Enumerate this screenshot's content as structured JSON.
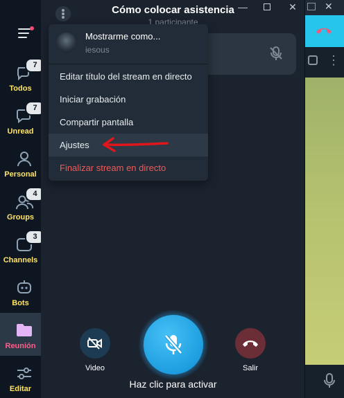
{
  "sidebar": {
    "folders": [
      {
        "label": "Todos",
        "badge": "7",
        "icon": "chat-bubbles-icon"
      },
      {
        "label": "Unread",
        "badge": "7",
        "icon": "chat-bubble-icon"
      },
      {
        "label": "Personal",
        "badge": "",
        "icon": "person-icon"
      },
      {
        "label": "Groups",
        "badge": "4",
        "icon": "people-icon"
      },
      {
        "label": "Channels",
        "badge": "3",
        "icon": "channel-icon"
      },
      {
        "label": "Bots",
        "badge": "",
        "icon": "bot-icon"
      },
      {
        "label": "Reunión",
        "badge": "",
        "icon": "folder-icon"
      },
      {
        "label": "Editar",
        "badge": "",
        "icon": "sliders-icon"
      }
    ]
  },
  "call": {
    "title": "Cómo colocar asistencia",
    "subtitle": "1 participante",
    "buttons": {
      "video": "Video",
      "leave": "Salir",
      "activate": "Haz clic para activar"
    }
  },
  "menu": {
    "profile_name": "Mostrarme como...",
    "profile_user": "iesous",
    "items": [
      "Editar título del stream en directo",
      "Iniciar grabación",
      "Compartir pantalla",
      "Ajustes",
      "Finalizar stream en directo"
    ]
  },
  "colors": {
    "accent": "#26a5e4",
    "folder_label": "#ffe466",
    "active_folder": "#ff5c8a",
    "danger": "#ef5b5b",
    "annotation_arrow": "#e0161b"
  }
}
